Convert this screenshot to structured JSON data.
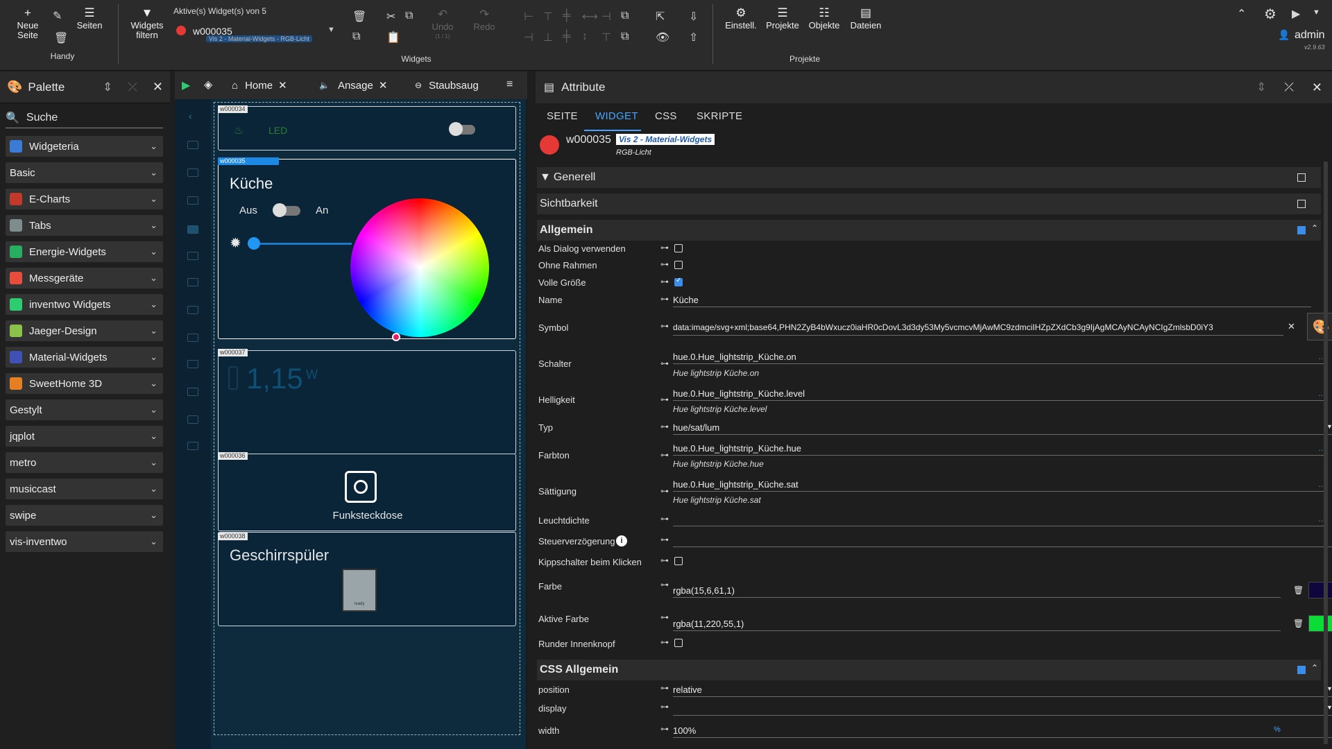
{
  "toolbar": {
    "new_page": "Neue Seite",
    "pages": "Seiten",
    "handy": "Handy",
    "widgets_filter": "Widgets filtern",
    "active_widgets": "Aktive(s) Widget(s) von 5",
    "widget_id": "w000035",
    "widget_set": "Vis 2 - Material-Widgets - RGB-Licht",
    "undo": "Undo",
    "undo_count": "(1 / 1)",
    "redo": "Redo",
    "widgets_group": "Widgets",
    "settings": "Einstell.",
    "projects": "Projekte",
    "objects": "Objekte",
    "files": "Dateien",
    "projects_group": "Projekte",
    "user": "admin",
    "version": "v2.9.63"
  },
  "palette": {
    "title": "Palette",
    "search": "Suche",
    "items": [
      {
        "label": "Widgeteria",
        "icon_color": "#3a7bd5"
      },
      {
        "label": "Basic",
        "icon_color": ""
      },
      {
        "label": "E-Charts",
        "icon_color": "#c0392b"
      },
      {
        "label": "Tabs",
        "icon_color": "#7f8c8d"
      },
      {
        "label": "Energie-Widgets",
        "icon_color": "#27ae60"
      },
      {
        "label": "Messgeräte",
        "icon_color": "#e74c3c"
      },
      {
        "label": "inventwo Widgets",
        "icon_color": "#2ecc71"
      },
      {
        "label": "Jaeger-Design",
        "icon_color": "#8bc34a"
      },
      {
        "label": "Material-Widgets",
        "icon_color": "#3f51b5"
      },
      {
        "label": "SweetHome 3D",
        "icon_color": "#e67e22"
      },
      {
        "label": "Gestylt",
        "icon_color": ""
      },
      {
        "label": "jqplot",
        "icon_color": ""
      },
      {
        "label": "metro",
        "icon_color": ""
      },
      {
        "label": "musiccast",
        "icon_color": ""
      },
      {
        "label": "swipe",
        "icon_color": ""
      },
      {
        "label": "vis-inventwo",
        "icon_color": ""
      }
    ]
  },
  "tabs": {
    "home": "Home",
    "ansage": "Ansage",
    "staubsauger": "Staubsaug"
  },
  "canvas": {
    "w34": "w000034",
    "led_label": "LED",
    "w35": "w000035",
    "kitchen_title": "Küche",
    "off": "Aus",
    "on": "An",
    "w37": "w000037",
    "power_value": "1,15",
    "power_unit": "W",
    "w36": "w000036",
    "socket_label": "Funksteckdose",
    "w38": "w000038",
    "dishwasher_title": "Geschirrspüler",
    "dishwasher_status": "ready"
  },
  "attr": {
    "title": "Attribute",
    "tabs": [
      "SEITE",
      "WIDGET",
      "CSS",
      "SKRIPTE"
    ],
    "widget_id": "w000035",
    "widget_set": "Vis 2 - Material-Widgets",
    "widget_type": "RGB-Licht",
    "sect_general": "Generell",
    "sect_visibility": "Sichtbarkeit",
    "sect_allgemein": "Allgemein",
    "sect_css": "CSS Allgemein",
    "labels": {
      "dialog": "Als Dialog verwenden",
      "no_frame": "Ohne Rahmen",
      "full_size": "Volle Größe",
      "name": "Name",
      "symbol": "Symbol",
      "switch": "Schalter",
      "brightness": "Helligkeit",
      "type": "Typ",
      "hue": "Farbton",
      "saturation": "Sättigung",
      "luminance": "Leuchtdichte",
      "delay": "Steuerverzögerung",
      "toggle": "Kippschalter beim Klicken",
      "color": "Farbe",
      "active_color": "Aktive Farbe",
      "round_knob": "Runder Innenknopf",
      "position": "position",
      "display": "display",
      "width": "width"
    },
    "values": {
      "name": "Küche",
      "symbol": "data:image/svg+xml;base64,PHN2ZyB4bWxucz0iaHR0cDovL3d3dy53My5vcmcvMjAwMC9zdmciIHZpZXdCb3g9IjAgMCAyNCAyNCIgZmlsbD0iY3",
      "switch": "hue.0.Hue_lightstrip_Küche.on",
      "switch_sub": "Hue lightstrip Küche.on",
      "brightness": "hue.0.Hue_lightstrip_Küche.level",
      "brightness_sub": "Hue lightstrip Küche.level",
      "type": "hue/sat/lum",
      "hue": "hue.0.Hue_lightstrip_Küche.hue",
      "hue_sub": "Hue lightstrip Küche.hue",
      "saturation": "hue.0.Hue_lightstrip_Küche.sat",
      "saturation_sub": "Hue lightstrip Küche.sat",
      "color": "rgba(15,6,61,1)",
      "active_color": "rgba(11,220,55,1)",
      "position": "relative",
      "width": "100%",
      "width_unit": "%"
    },
    "colors": {
      "color_swatch": "#0f063d",
      "active_swatch": "#0bdc37",
      "accent": "#4aa3ff"
    }
  }
}
